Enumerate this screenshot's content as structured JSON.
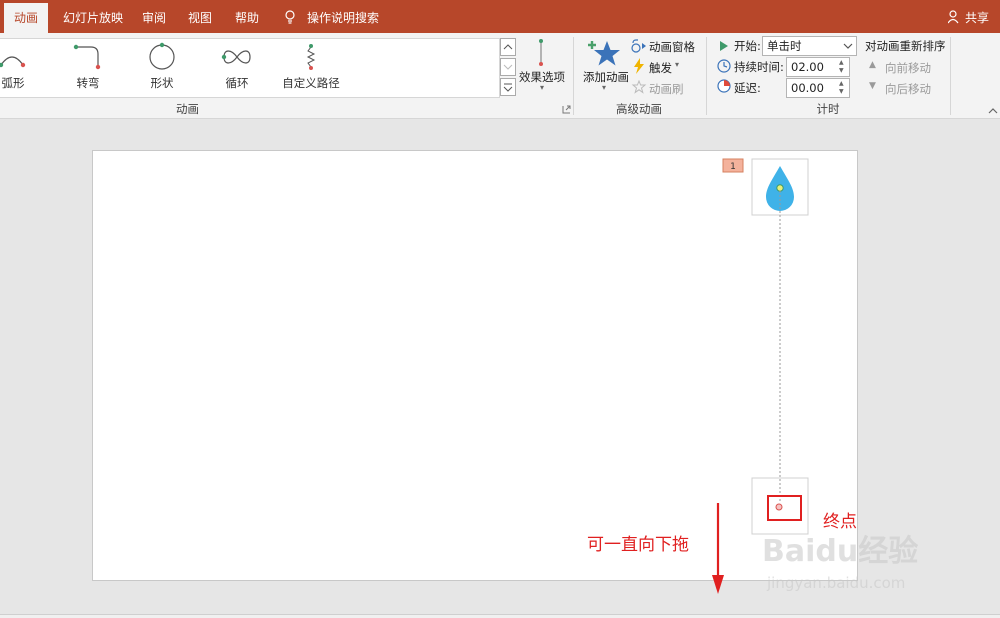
{
  "tabs": {
    "items": [
      "动画",
      "幻灯片放映",
      "审阅",
      "视图",
      "帮助"
    ],
    "search": "操作说明搜索",
    "share": "共享"
  },
  "ribbon": {
    "gallery": [
      "弧形",
      "转弯",
      "形状",
      "循环",
      "自定义路径"
    ],
    "effect_options": "效果选项",
    "group_animation": "动画",
    "add_animation": "添加动画",
    "animation_pane": "动画窗格",
    "trigger": "触发",
    "animation_painter": "动画刷",
    "group_advanced": "高级动画",
    "start_label": "开始:",
    "start_value": "单击时",
    "duration_label": "持续时间:",
    "duration_value": "02.00",
    "delay_label": "延迟:",
    "delay_value": "00.00",
    "group_timing": "计时",
    "reorder_title": "对动画重新排序",
    "move_earlier": "向前移动",
    "move_later": "向后移动"
  },
  "slide": {
    "badge": "1",
    "endpoint_label": "终点",
    "drag_hint": "可一直向下拖"
  },
  "watermark": {
    "logo": "Baidu经验",
    "url": "jingyan.baidu.com"
  },
  "colors": {
    "accent": "#b7472a",
    "drop": "#3fb2e8",
    "annotation": "#e02020"
  }
}
